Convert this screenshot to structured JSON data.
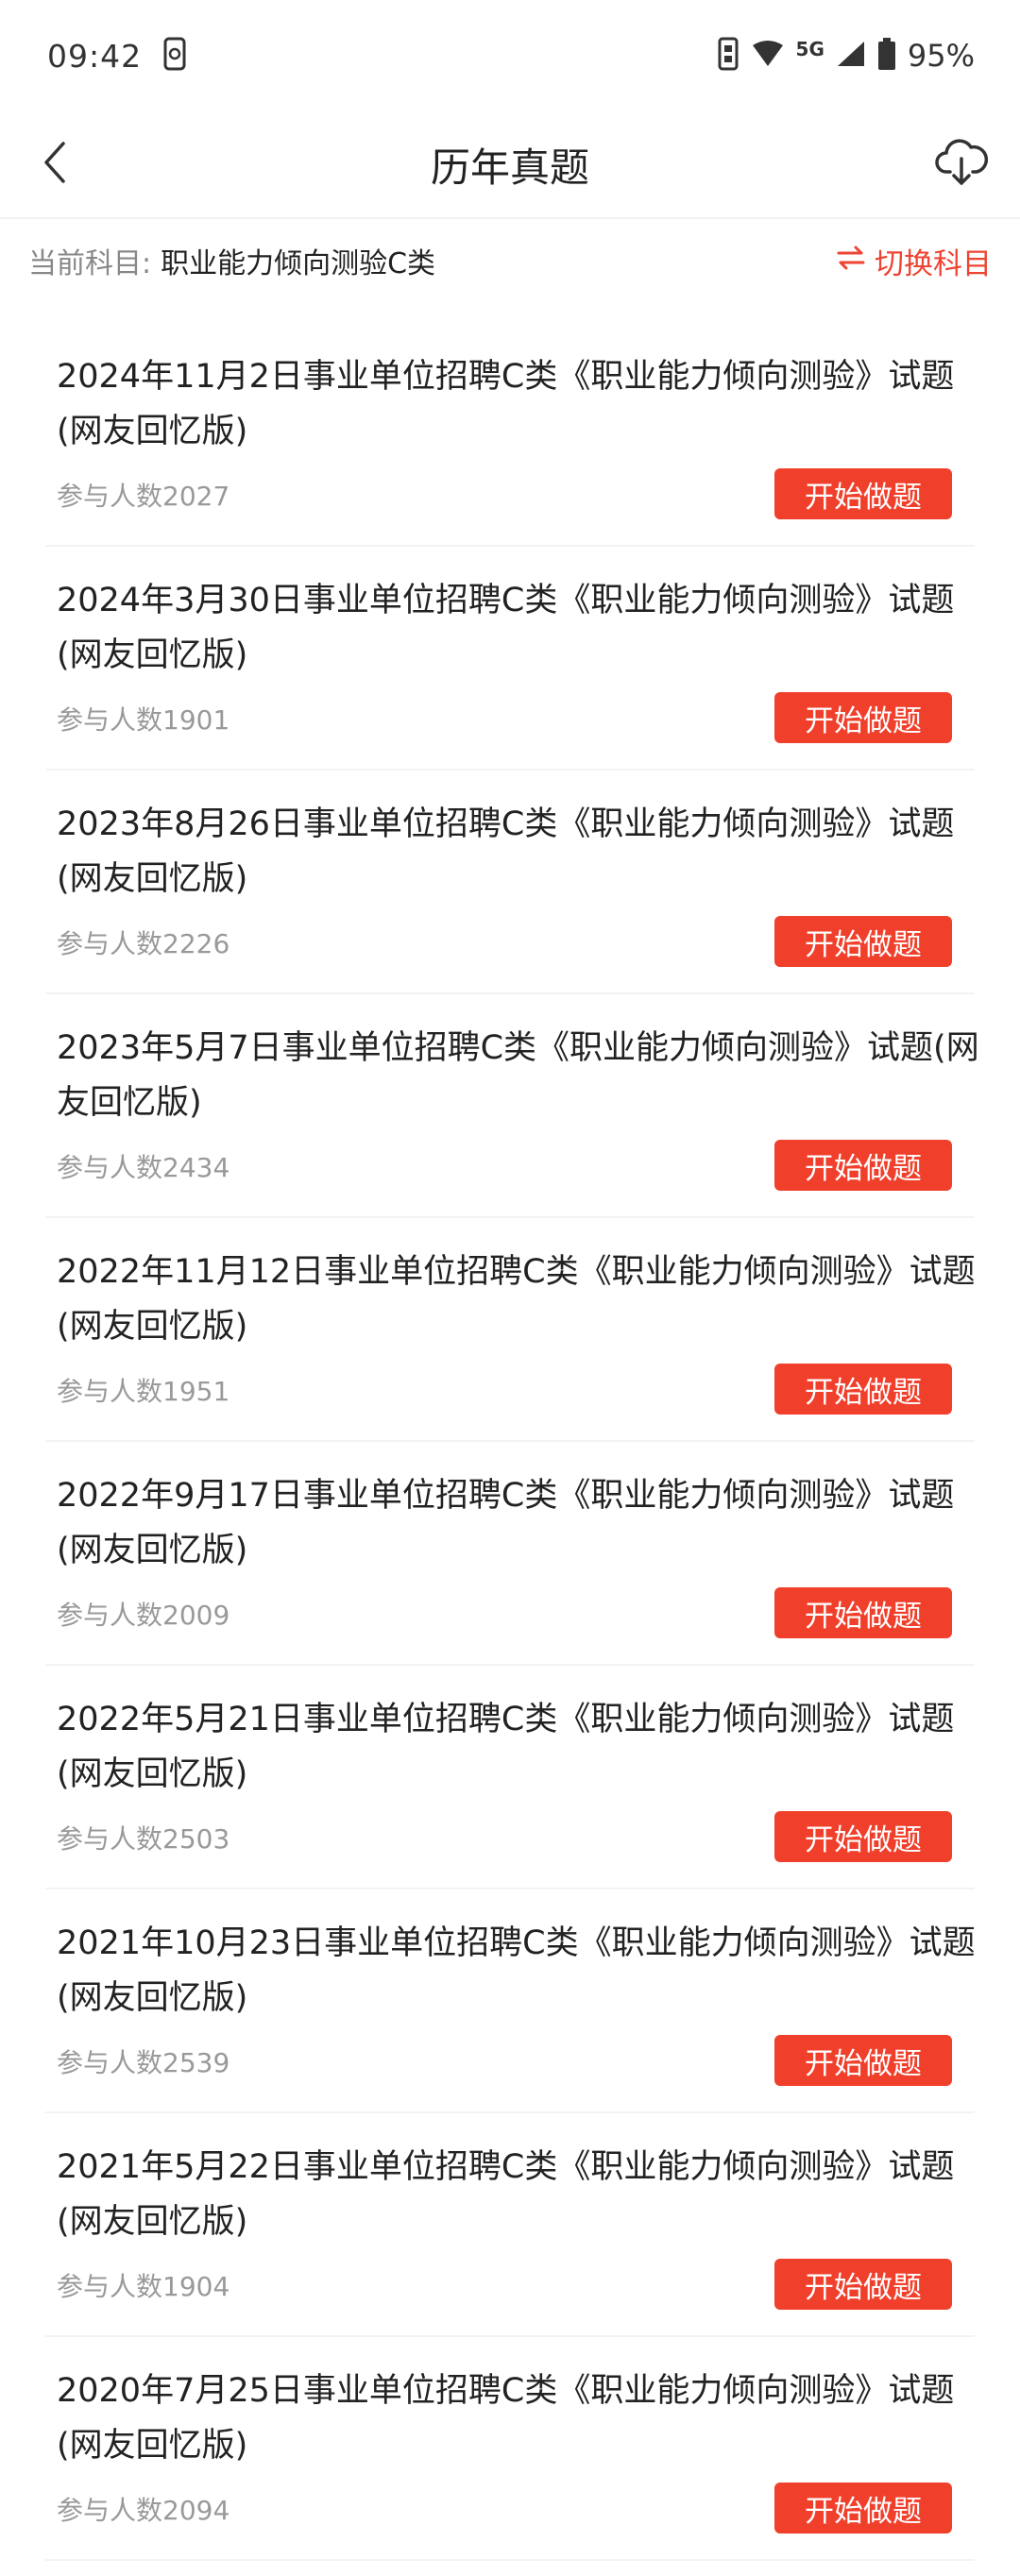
{
  "status_bar": {
    "time": "09:42",
    "network": "5G",
    "battery": "95%"
  },
  "header": {
    "title": "历年真题"
  },
  "subject": {
    "label": "当前科目:",
    "value": "职业能力倾向测验C类",
    "switch_label": "切换科目"
  },
  "colors": {
    "accent": "#f0402c",
    "switch_text": "#ee4433"
  },
  "icons": [
    "back-chevron-icon",
    "cloud-download-icon",
    "switch-arrows-icon"
  ],
  "button_label": "开始做题",
  "items": [
    {
      "title": "2024年11月2日事业单位招聘C类《职业能力倾向测验》试题(网友回忆版)",
      "count": "参与人数2027"
    },
    {
      "title": "2024年3月30日事业单位招聘C类《职业能力倾向测验》试题(网友回忆版)",
      "count": "参与人数1901"
    },
    {
      "title": "2023年8月26日事业单位招聘C类《职业能力倾向测验》试题(网友回忆版)",
      "count": "参与人数2226"
    },
    {
      "title": "2023年5月7日事业单位招聘C类《职业能力倾向测验》试题(网友回忆版)",
      "count": "参与人数2434"
    },
    {
      "title": "2022年11月12日事业单位招聘C类《职业能力倾向测验》试题(网友回忆版)",
      "count": "参与人数1951"
    },
    {
      "title": "2022年9月17日事业单位招聘C类《职业能力倾向测验》试题(网友回忆版)",
      "count": "参与人数2009"
    },
    {
      "title": "2022年5月21日事业单位招聘C类《职业能力倾向测验》试题(网友回忆版)",
      "count": "参与人数2503"
    },
    {
      "title": "2021年10月23日事业单位招聘C类《职业能力倾向测验》试题(网友回忆版)",
      "count": "参与人数2539"
    },
    {
      "title": "2021年5月22日事业单位招聘C类《职业能力倾向测验》试题(网友回忆版)",
      "count": "参与人数1904"
    },
    {
      "title": "2020年7月25日事业单位招聘C类《职业能力倾向测验》试题(网友回忆版)",
      "count": "参与人数2094"
    }
  ]
}
